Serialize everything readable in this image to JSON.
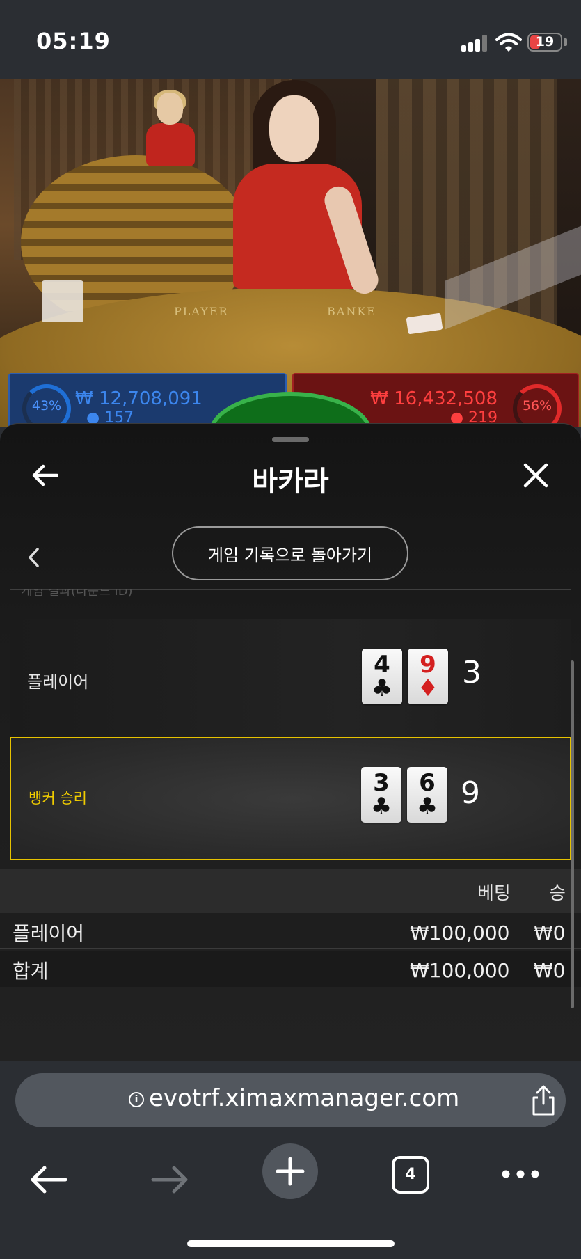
{
  "status_bar": {
    "time": "05:19",
    "battery": "19",
    "battery_color": "#e84545"
  },
  "video": {
    "table_player_label": "PLAYER",
    "table_banker_label": "BANKE",
    "player_bet": {
      "percent": "43%",
      "amount": "₩ 12,708,091",
      "count": "● 157"
    },
    "banker_bet": {
      "percent": "56%",
      "amount": "₩ 16,432,508",
      "count": "● 219"
    }
  },
  "sheet": {
    "title": "바카라",
    "return_button": "게임 기록으로 돌아가기",
    "faded_text": "게임 결과(라운드 ID)",
    "hands": [
      {
        "label": "플레이어",
        "cards": [
          {
            "rank": "4",
            "suit": "♣",
            "color": "black"
          },
          {
            "rank": "9",
            "suit": "♦",
            "color": "red"
          }
        ],
        "score": "3"
      },
      {
        "label": "뱅커 승리",
        "cards": [
          {
            "rank": "3",
            "suit": "♣",
            "color": "black"
          },
          {
            "rank": "6",
            "suit": "♣",
            "color": "black"
          }
        ],
        "score": "9"
      }
    ],
    "summary": {
      "columns": {
        "bet": "베팅",
        "win": "승"
      },
      "rows": [
        {
          "label": "플레이어",
          "bet": "₩100,000",
          "win": "₩0"
        },
        {
          "label": "합계",
          "bet": "₩100,000",
          "win": "₩0"
        }
      ]
    },
    "accent_color": "#e6c200"
  },
  "browser": {
    "url": "evotrf.ximaxmanager.com",
    "tab_count": "4"
  }
}
